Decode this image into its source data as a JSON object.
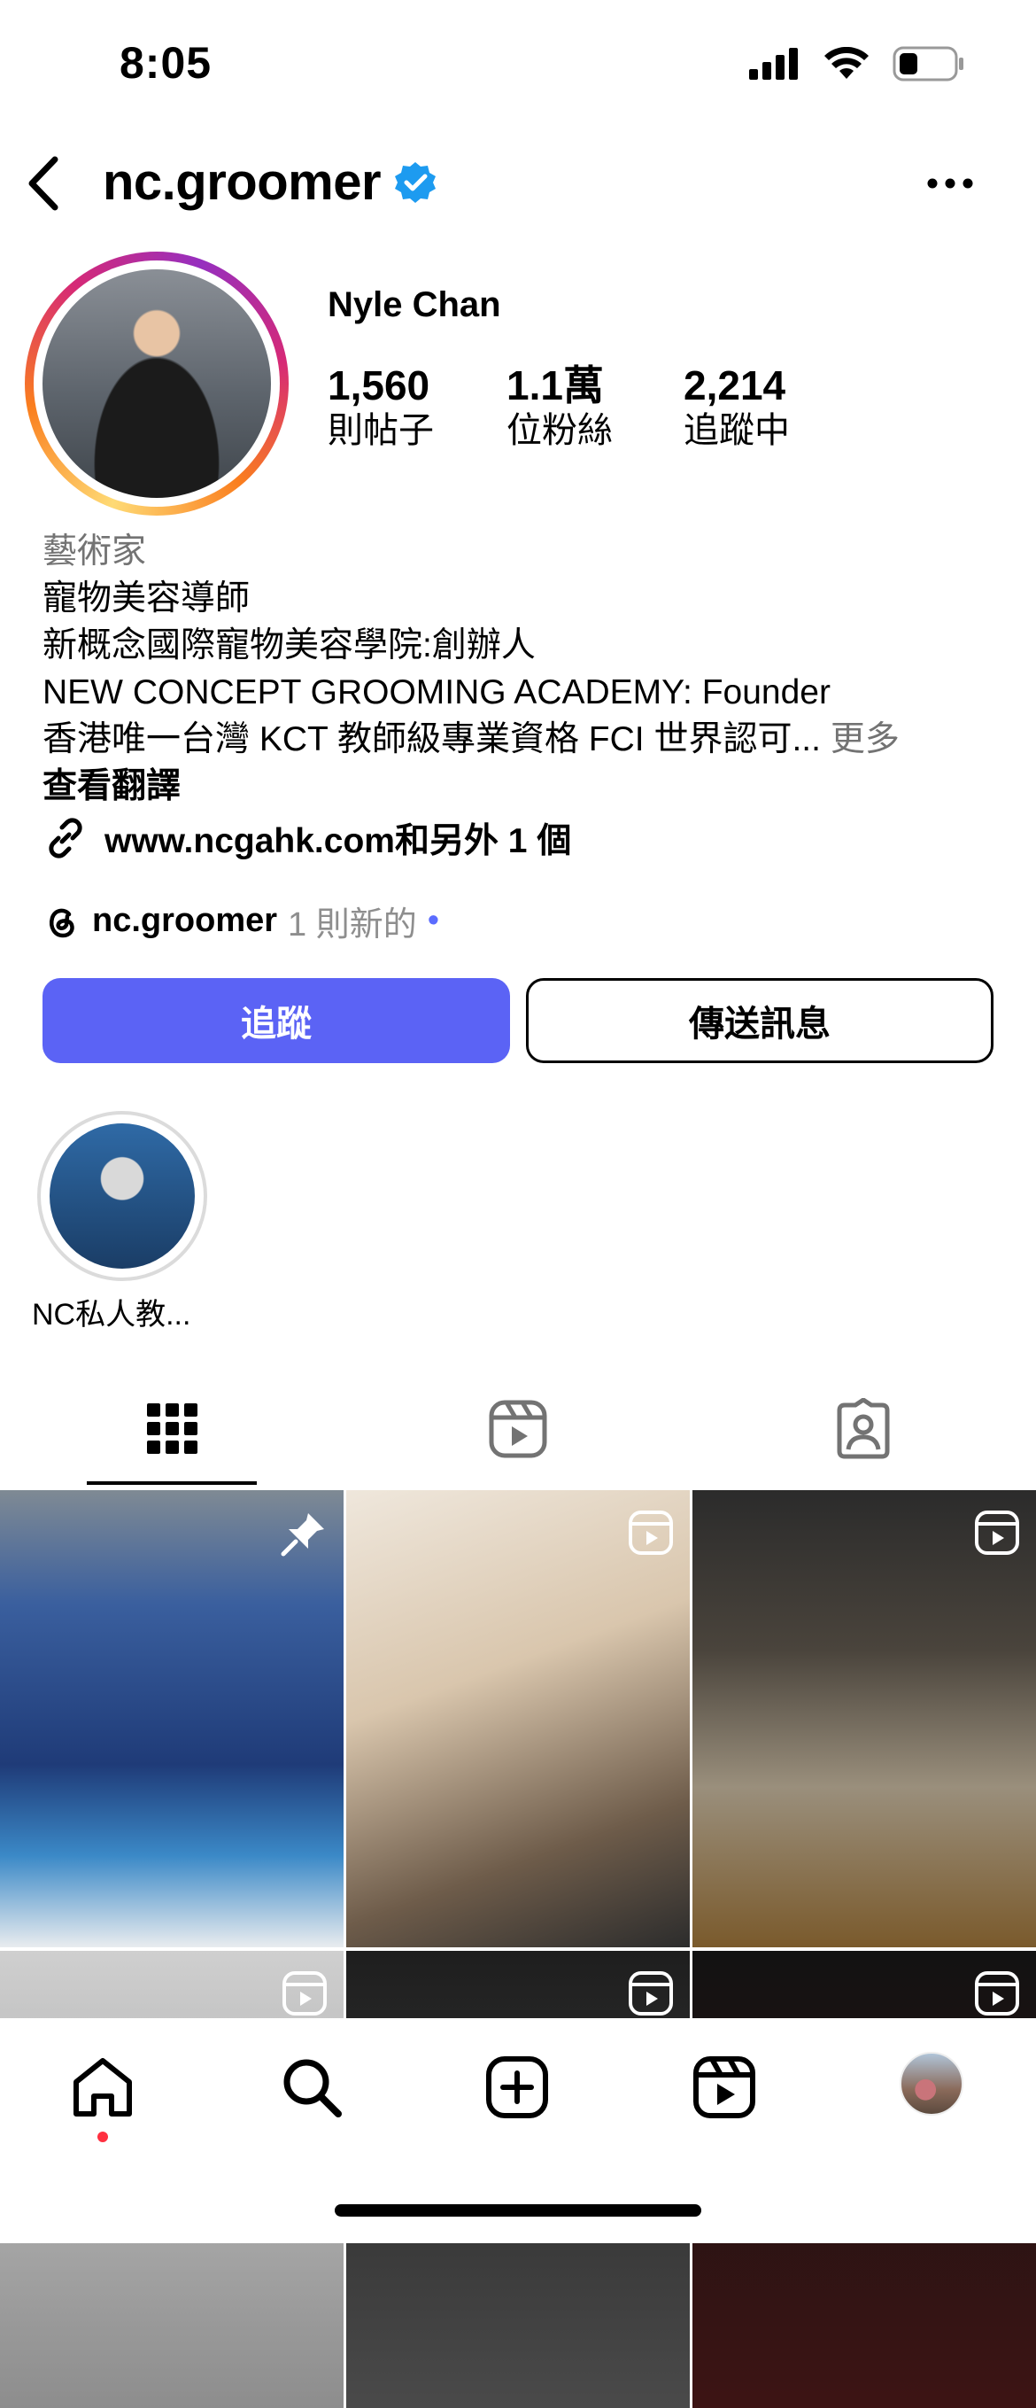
{
  "status_bar": {
    "time": "8:05"
  },
  "header": {
    "username": "nc.groomer",
    "verified": true
  },
  "profile": {
    "full_name": "Nyle Chan",
    "stats": [
      {
        "value": "1,560",
        "label": "則帖子"
      },
      {
        "value": "1.1萬",
        "label": "位粉絲"
      },
      {
        "value": "2,214",
        "label": "追蹤中"
      }
    ]
  },
  "bio": {
    "category": "藝術家",
    "lines": [
      "寵物美容導師",
      "新概念國際寵物美容學院:創辦人",
      "NEW CONCEPT GROOMING ACADEMY: Founder",
      "香港唯一台灣 KCT 教師級專業資格 FCI 世界認可..."
    ],
    "more": "更多",
    "translate": "查看翻譯",
    "link": "www.ncgahk.com和另外 1 個"
  },
  "threads": {
    "handle": "nc.groomer",
    "new_text": "1 則新的"
  },
  "buttons": {
    "follow": "追蹤",
    "message": "傳送訊息"
  },
  "highlights": [
    {
      "label": "NC私人教..."
    }
  ],
  "grid": {
    "posts": [
      {
        "type": "pinned",
        "colors": [
          "#3a5f9e",
          "#1f3b78"
        ]
      },
      {
        "type": "reel",
        "colors": [
          "#d9c6ad",
          "#6e5c4a"
        ]
      },
      {
        "type": "reel",
        "colors": [
          "#2b2b2b",
          "#9a8f7c"
        ]
      },
      {
        "type": "reel",
        "colors": [
          "#cfcfcf",
          "#8d8d8d"
        ]
      },
      {
        "type": "reel",
        "colors": [
          "#1e1e1e",
          "#4a4a4a"
        ]
      },
      {
        "type": "reel",
        "colors": [
          "#121212",
          "#3d1414"
        ]
      }
    ]
  },
  "icons": {
    "back": "chevron-left-icon",
    "verified": "verified-badge-icon",
    "more": "more-horizontal-icon",
    "link": "link-icon",
    "threads": "threads-icon",
    "grid_tab": "grid-icon",
    "reels_tab": "reels-icon",
    "tagged_tab": "tagged-icon",
    "home": "home-icon",
    "search": "search-icon",
    "create": "create-icon",
    "reels": "reels-icon"
  },
  "colors": {
    "accent_button": "#5b63f5",
    "verified": "#1d9bf0",
    "notification_dot": "#ff3040"
  }
}
